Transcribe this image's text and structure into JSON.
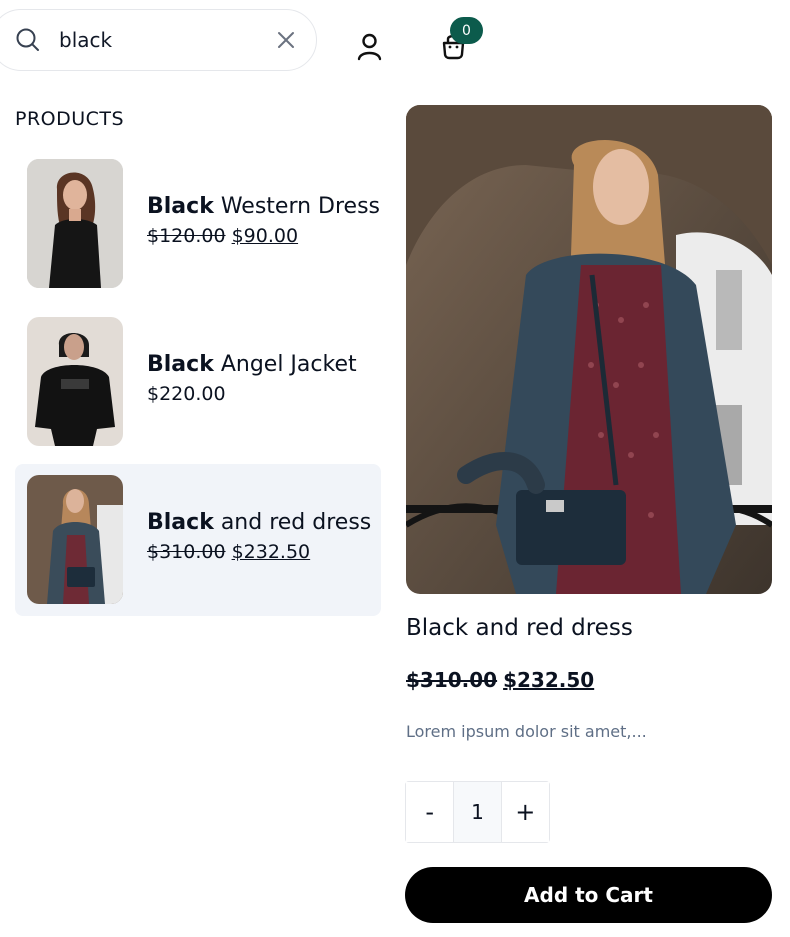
{
  "header": {
    "search": {
      "value": "black",
      "placeholder": "Search"
    },
    "cart_count": "0"
  },
  "section_label": "PRODUCTS",
  "results": [
    {
      "name_match": "Black",
      "name_rest": " Western Dress",
      "old_price": "$120.00",
      "price": "$90.00"
    },
    {
      "name_match": "Black",
      "name_rest": " Angel Jacket",
      "old_price": "",
      "price": "$220.00"
    },
    {
      "name_match": "Black",
      "name_rest": " and red dress",
      "old_price": "$310.00",
      "price": "$232.50"
    }
  ],
  "detail": {
    "title": "Black and red dress",
    "old_price": "$310.00",
    "price": "$232.50",
    "description": "Lorem ipsum dolor sit amet,...",
    "quantity": "1",
    "minus_label": "-",
    "plus_label": "+",
    "add_to_cart_label": "Add to Cart"
  },
  "colors": {
    "badge": "#0c5b4c",
    "active_row": "#f1f4f9",
    "description": "#5f6f86",
    "button": "#000000"
  },
  "icons": {
    "search": "search-icon",
    "clear": "close-icon",
    "account": "user-icon",
    "cart": "shopping-bag-icon"
  }
}
